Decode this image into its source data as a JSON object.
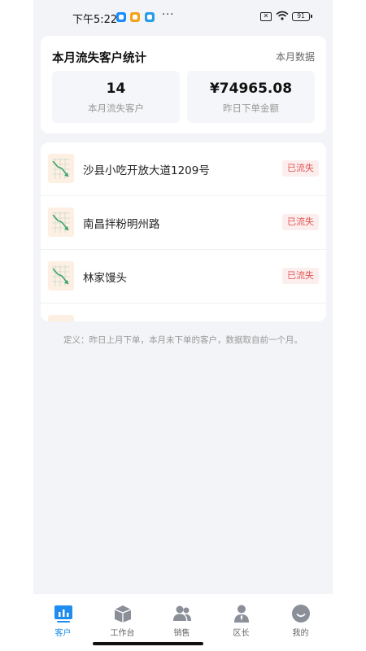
{
  "status_bar": {
    "time": "下午5:22",
    "more": "···",
    "sim": "✕",
    "battery": "91"
  },
  "stats": {
    "title": "本月流失客户统计",
    "period_link": "本月数据",
    "lost_count": "14",
    "lost_count_label": "本月流失客户",
    "amount": "¥74965.08",
    "amount_label": "昨日下单金额"
  },
  "customers": [
    {
      "name": "沙县小吃开放大道1209号",
      "status": "已流失"
    },
    {
      "name": "南昌拌粉明州路",
      "status": "已流失"
    },
    {
      "name": "林家馒头",
      "status": "已流失"
    }
  ],
  "definition": "定义：昨日上月下单，本月未下单的客户，数据取自前一个月。",
  "tabs": [
    {
      "label": "客户",
      "icon": "customer-chart-icon",
      "active": true
    },
    {
      "label": "工作台",
      "icon": "workbench-box-icon",
      "active": false
    },
    {
      "label": "销售",
      "icon": "sales-people-icon",
      "active": false
    },
    {
      "label": "区长",
      "icon": "manager-person-icon",
      "active": false
    },
    {
      "label": "我的",
      "icon": "profile-face-icon",
      "active": false
    }
  ],
  "colors": {
    "accent": "#1f8df0",
    "badge_text": "#e05555",
    "badge_bg": "#fdeeee",
    "page_bg": "#f3f4f7"
  }
}
